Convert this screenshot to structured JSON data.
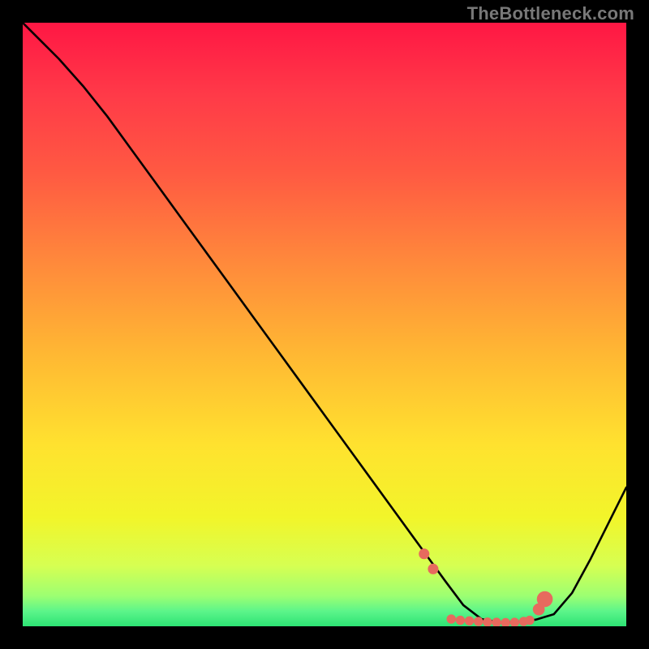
{
  "watermark": "TheBottleneck.com",
  "chart_data": {
    "type": "line",
    "title": "",
    "xlabel": "",
    "ylabel": "",
    "xlim": [
      0,
      100
    ],
    "ylim": [
      0,
      100
    ],
    "x": [
      0,
      3,
      6,
      10,
      14,
      18,
      22,
      26,
      30,
      34,
      38,
      42,
      46,
      50,
      54,
      58,
      62,
      66,
      70,
      73,
      76,
      79,
      82,
      85,
      88,
      91,
      94,
      97,
      100
    ],
    "values": [
      100,
      97,
      94,
      89.5,
      84.5,
      79,
      73.5,
      68,
      62.5,
      57,
      51.5,
      46,
      40.5,
      35,
      29.5,
      24,
      18.5,
      13,
      7.5,
      3.5,
      1.2,
      0.6,
      0.7,
      1.1,
      2.0,
      5.5,
      11,
      17,
      23
    ],
    "background_gradient": {
      "type": "linear-vertical",
      "stops": [
        {
          "offset": 0.0,
          "color": "#ff1744"
        },
        {
          "offset": 0.12,
          "color": "#ff3a48"
        },
        {
          "offset": 0.25,
          "color": "#ff5a42"
        },
        {
          "offset": 0.4,
          "color": "#ff8a3b"
        },
        {
          "offset": 0.55,
          "color": "#ffb833"
        },
        {
          "offset": 0.7,
          "color": "#ffe22f"
        },
        {
          "offset": 0.82,
          "color": "#f2f52a"
        },
        {
          "offset": 0.9,
          "color": "#d6ff52"
        },
        {
          "offset": 0.95,
          "color": "#9cff72"
        },
        {
          "offset": 0.975,
          "color": "#5cf58a"
        },
        {
          "offset": 1.0,
          "color": "#2de374"
        }
      ]
    },
    "curve_color": "#000000",
    "marker_color": "#e76a5e",
    "markers": {
      "x": [
        66.5,
        68.0,
        71.0,
        72.5,
        74.0,
        75.5,
        77.0,
        78.5,
        80.0,
        81.5,
        83.0,
        84.0,
        85.5,
        86.5
      ],
      "y": [
        12.0,
        9.5,
        1.2,
        1.0,
        0.9,
        0.8,
        0.7,
        0.65,
        0.6,
        0.65,
        0.8,
        1.0,
        2.8,
        4.5
      ],
      "size": [
        1.6,
        1.6,
        1.4,
        1.4,
        1.4,
        1.4,
        1.4,
        1.4,
        1.4,
        1.4,
        1.4,
        1.4,
        1.8,
        2.4
      ]
    }
  }
}
